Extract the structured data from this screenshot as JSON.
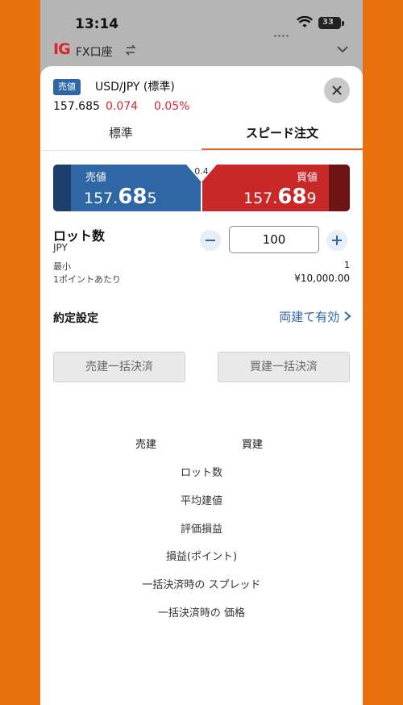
{
  "status_bar": {
    "time": "13:14",
    "battery": "33"
  },
  "account_bar": {
    "logo": "IG",
    "account_name": "FX口座"
  },
  "instrument": {
    "side_tag": "売値",
    "name": "USD/JPY (標準)",
    "price": "157.685",
    "change": "0.074",
    "change_pct": "0.05%"
  },
  "tabs": [
    {
      "label": "標準",
      "active": false
    },
    {
      "label": "スピード注文",
      "active": true
    }
  ],
  "quote": {
    "sell": {
      "label": "売値",
      "price_small": "157.",
      "price_big": "68",
      "price_tail": "5"
    },
    "buy": {
      "label": "買値",
      "price_small": "157.",
      "price_big": "68",
      "price_tail": "9"
    },
    "spread": "0.4"
  },
  "lot": {
    "label": "ロット数",
    "unit": "JPY",
    "value": "100",
    "min_label": "最小",
    "min_value": "1",
    "per_point_label": "1ポイントあたり",
    "per_point_value": "¥10,000.00"
  },
  "execution": {
    "label": "約定設定",
    "value": "両建て有効"
  },
  "buttons": {
    "close_all_sell": "売建一括決済",
    "close_all_buy": "買建一括決済"
  },
  "summary": {
    "sell_header": "売建",
    "buy_header": "買建",
    "rows": [
      "ロット数",
      "平均建値",
      "評価損益",
      "損益(ポイント)",
      "一括決済時の スプレッド",
      "一括決済時の 価格"
    ]
  },
  "colors": {
    "accent_blue": "#2f66a6",
    "sell": "#2f66a6",
    "buy": "#c82828",
    "tab_underline": "#e8632a",
    "background": "#e8710e"
  }
}
